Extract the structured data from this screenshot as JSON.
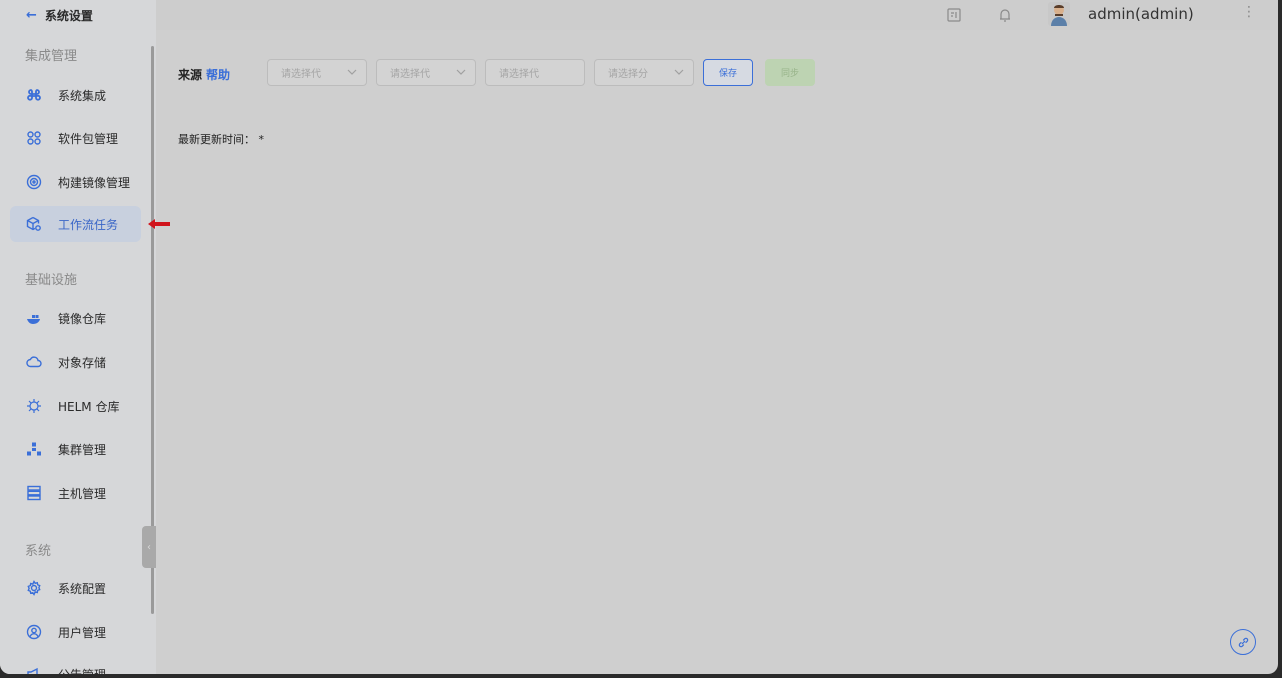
{
  "sidebar": {
    "back_label": "系统设置",
    "sections": [
      {
        "title": "集成管理"
      },
      {
        "title": "基础设施"
      },
      {
        "title": "系统"
      }
    ],
    "items": [
      {
        "label": "系统集成",
        "icon": "command-icon"
      },
      {
        "label": "软件包管理",
        "icon": "grid-icon"
      },
      {
        "label": "构建镜像管理",
        "icon": "disc-icon"
      },
      {
        "label": "工作流任务",
        "icon": "cube-settings-icon",
        "active": true
      },
      {
        "label": "镜像仓库",
        "icon": "docker-icon"
      },
      {
        "label": "对象存储",
        "icon": "cloud-icon"
      },
      {
        "label": "HELM 仓库",
        "icon": "helm-icon"
      },
      {
        "label": "集群管理",
        "icon": "cluster-icon"
      },
      {
        "label": "主机管理",
        "icon": "server-icon"
      },
      {
        "label": "系统配置",
        "icon": "gear-icon"
      },
      {
        "label": "用户管理",
        "icon": "user-icon"
      },
      {
        "label": "公告管理",
        "icon": "announcement-icon"
      }
    ]
  },
  "header": {
    "user_name": "admin(admin)",
    "icons": [
      "document-icon",
      "bell-icon",
      "avatar",
      "more-icon"
    ]
  },
  "main": {
    "source_label": "来源",
    "help_label": "帮助",
    "selects": [
      {
        "placeholder": "请选择代"
      },
      {
        "placeholder": "请选择代"
      },
      {
        "placeholder": "请选择代"
      },
      {
        "placeholder": "请选择分"
      }
    ],
    "save_label": "保存",
    "sync_label": "同步",
    "update_time_label": "最新更新时间：",
    "update_time_value": "*"
  },
  "colors": {
    "accent": "#3b6fd8",
    "sync_button": "#bdd3b2",
    "active_item_bg": "#c8d0de"
  }
}
